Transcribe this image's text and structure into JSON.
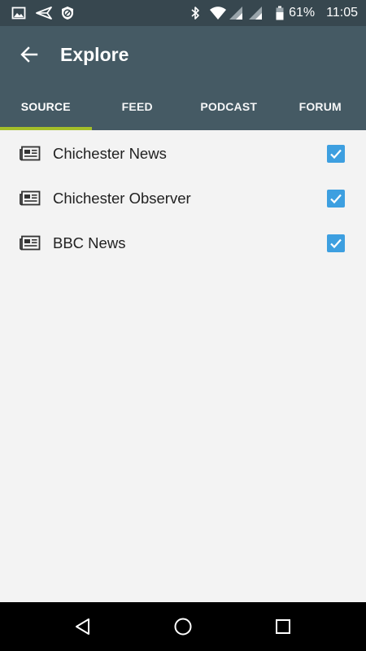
{
  "status_bar": {
    "battery_percent": "61%",
    "time": "11:05",
    "icons": [
      "image-icon",
      "send-icon",
      "blocked-shield-icon",
      "bluetooth-icon",
      "wifi-icon",
      "signal-icon",
      "signal-icon-2",
      "battery-icon"
    ]
  },
  "app_bar": {
    "title": "Explore",
    "back_icon": "arrow-back-icon"
  },
  "tabs": [
    {
      "label": "SOURCE",
      "active": true
    },
    {
      "label": "FEED",
      "active": false
    },
    {
      "label": "PODCAST",
      "active": false
    },
    {
      "label": "FORUM",
      "active": false
    }
  ],
  "sources": [
    {
      "name": "Chichester News",
      "checked": true,
      "icon": "newspaper-icon"
    },
    {
      "name": "Chichester Observer",
      "checked": true,
      "icon": "newspaper-icon"
    },
    {
      "name": "BBC News",
      "checked": true,
      "icon": "newspaper-icon"
    }
  ],
  "nav_bar": {
    "icons": [
      "nav-back-icon",
      "nav-home-icon",
      "nav-recents-icon"
    ]
  },
  "colors": {
    "status_bar": "#37474f",
    "app_bar": "#455a64",
    "tab_indicator": "#a4bf2a",
    "checkbox": "#3d9fe0",
    "background": "#f3f3f3"
  }
}
